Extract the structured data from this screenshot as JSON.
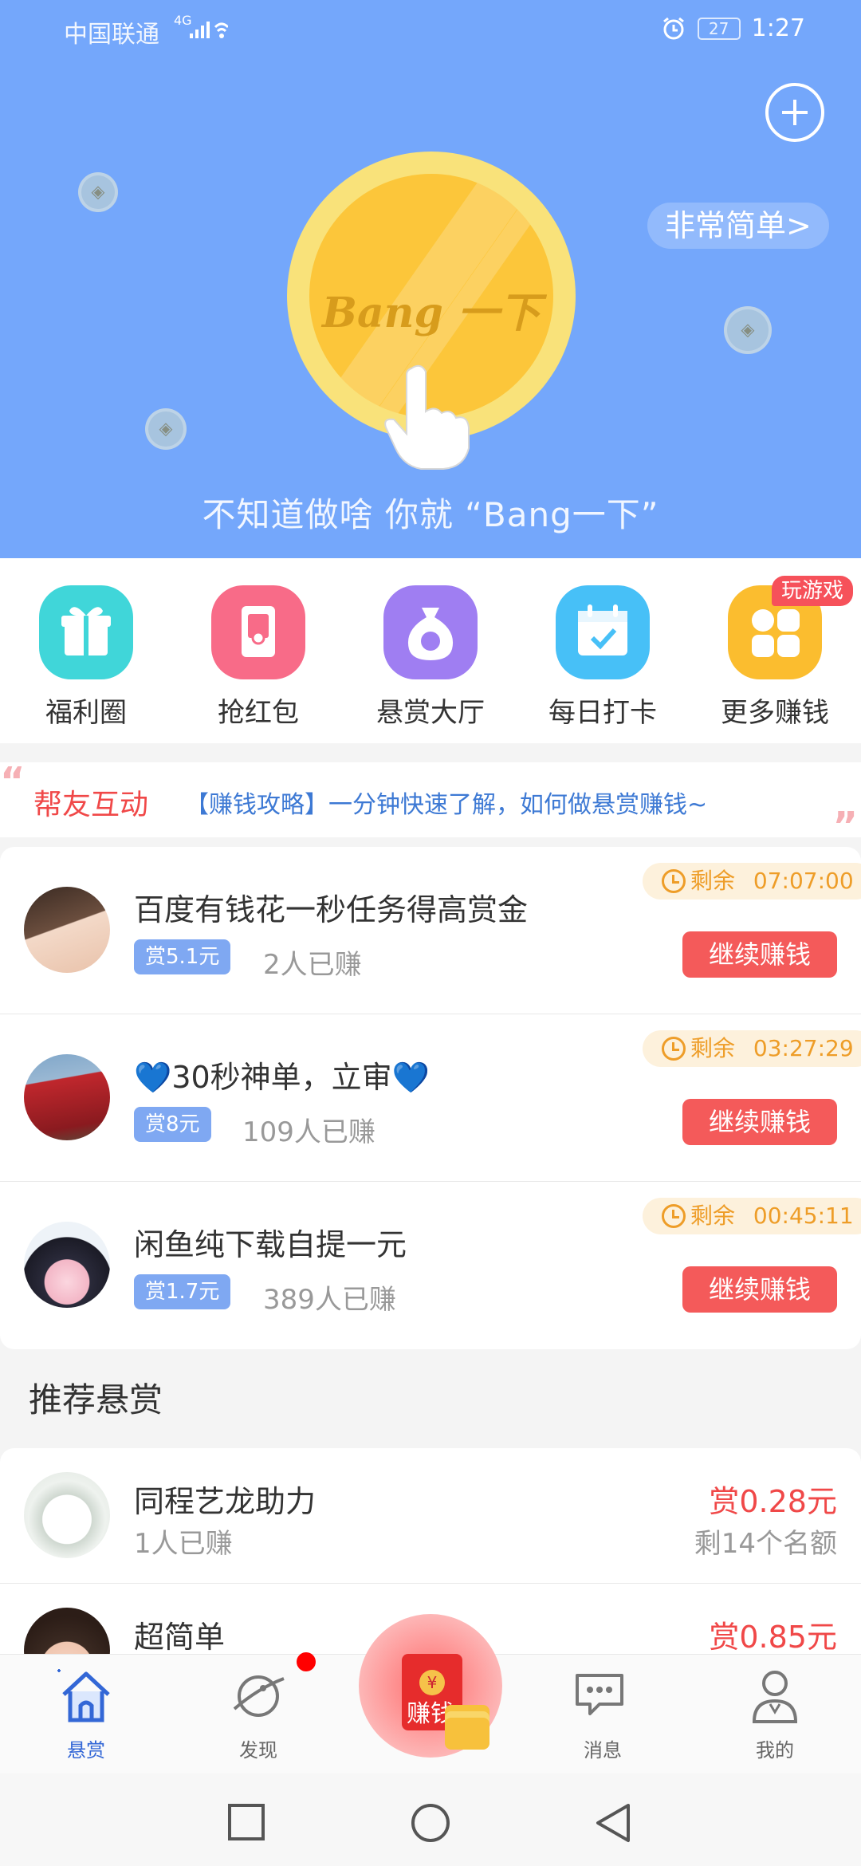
{
  "status_bar": {
    "carrier": "中国联通",
    "network": "4G",
    "battery": "27",
    "time": "1:27"
  },
  "hero": {
    "simple_pill": "非常简单>",
    "coin_text": "Bang 一下",
    "slogan": "不知道做啥 你就 “Bang一下”",
    "colors": {
      "background": "#74a7fb",
      "coin": "#fcc63a"
    }
  },
  "quick_menu": {
    "items": [
      {
        "label": "福利圈",
        "icon": "gift-icon",
        "color": "#40d6d9"
      },
      {
        "label": "抢红包",
        "icon": "red-packet-icon",
        "color": "#f86b88"
      },
      {
        "label": "悬赏大厅",
        "icon": "money-bag-icon",
        "color": "#9f7ef2"
      },
      {
        "label": "每日打卡",
        "icon": "calendar-check-icon",
        "color": "#47c0f7"
      },
      {
        "label": "更多赚钱",
        "icon": "grid-coins-icon",
        "color": "#fbbd2f"
      }
    ],
    "game_badge": "玩游戏"
  },
  "notice": {
    "title": "帮友互动",
    "message": "【赚钱攻略】一分钟快速了解，如何做悬赏赚钱~"
  },
  "tasks": [
    {
      "title": "百度有钱花一秒任务得高赏金",
      "reward": "赏5.1元",
      "earned": "2人已赚",
      "timer_prefix": "剩余",
      "timer": "07:07:00",
      "button": "继续赚钱"
    },
    {
      "title": "💙30秒神单，立审💙",
      "reward": "赏8元",
      "earned": "109人已赚",
      "timer_prefix": "剩余",
      "timer": "03:27:29",
      "button": "继续赚钱"
    },
    {
      "title": "闲鱼纯下载自提一元",
      "reward": "赏1.7元",
      "earned": "389人已赚",
      "timer_prefix": "剩余",
      "timer": "00:45:11",
      "button": "继续赚钱"
    }
  ],
  "recommended": {
    "section_title": "推荐悬赏",
    "items": [
      {
        "title": "同程艺龙助力",
        "earned": "1人已赚",
        "reward": "赏0.28元",
        "remaining": "剩14个名额"
      },
      {
        "title": "超简单",
        "earned": "",
        "reward": "赏0.85元",
        "remaining": ""
      }
    ]
  },
  "tab_bar": {
    "tabs": [
      {
        "label": "悬赏",
        "icon": "home-icon",
        "active": true
      },
      {
        "label": "发现",
        "icon": "planet-icon",
        "active": false
      },
      {
        "label": "赚钱",
        "icon": "red-packet-icon",
        "active": false
      },
      {
        "label": "消息",
        "icon": "chat-icon",
        "active": false
      },
      {
        "label": "我的",
        "icon": "user-icon",
        "active": false
      }
    ]
  }
}
